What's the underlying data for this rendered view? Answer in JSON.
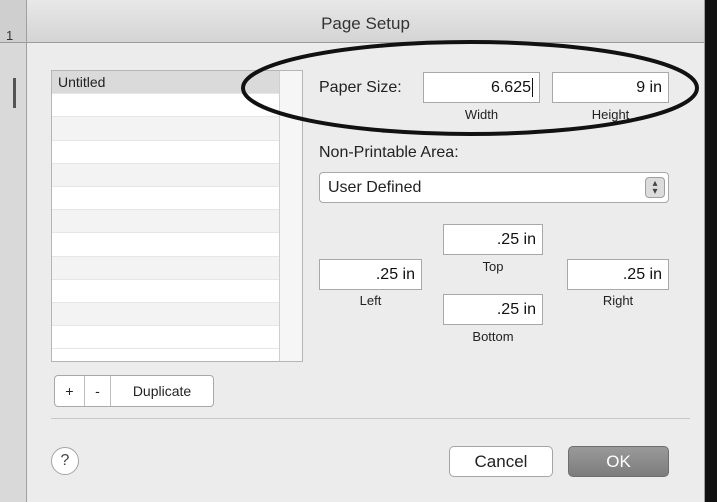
{
  "background": {
    "left_mark": "1"
  },
  "dialog": {
    "title": "Page Setup",
    "list": {
      "items": [
        "Untitled",
        "",
        "",
        "",
        "",
        "",
        "",
        "",
        "",
        "",
        "",
        ""
      ],
      "selected_index": 0
    },
    "list_buttons": {
      "add": "+",
      "remove": "-",
      "duplicate": "Duplicate"
    },
    "paper_size": {
      "label": "Paper Size:",
      "width_value": "6.625",
      "width_caption": "Width",
      "height_value": "9 in",
      "height_caption": "Height"
    },
    "non_printable": {
      "label": "Non-Printable Area:",
      "selected": "User Defined",
      "top_value": ".25 in",
      "top_caption": "Top",
      "left_value": ".25 in",
      "left_caption": "Left",
      "right_value": ".25 in",
      "right_caption": "Right",
      "bottom_value": ".25 in",
      "bottom_caption": "Bottom"
    },
    "help": "?",
    "cancel_label": "Cancel",
    "ok_label": "OK"
  }
}
